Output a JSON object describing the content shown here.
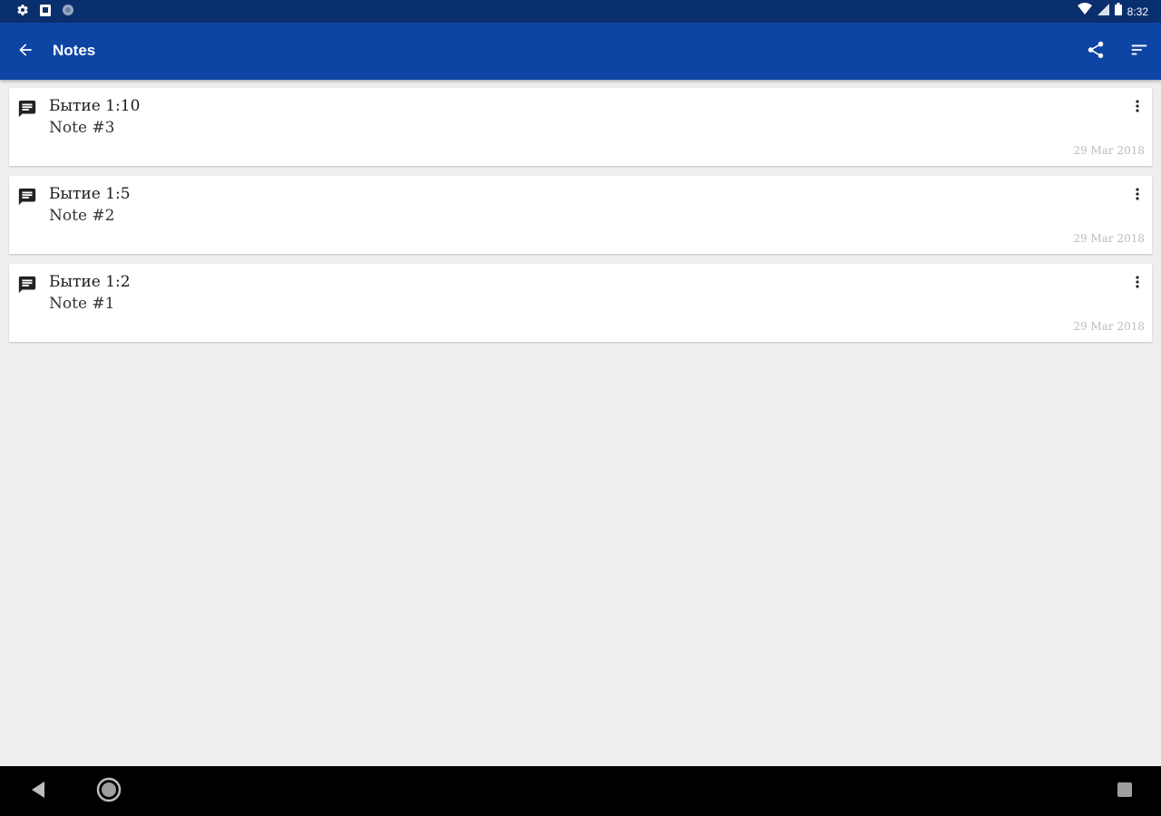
{
  "status_bar": {
    "time": "8:32",
    "left_icons": [
      "settings-icon",
      "sd-card-icon",
      "circle-status-icon"
    ],
    "right_icons": [
      "wifi-icon",
      "signal-icon",
      "battery-icon"
    ]
  },
  "app_bar": {
    "title": "Notes",
    "back_icon": "arrow-back-icon",
    "actions": [
      "share-icon",
      "sort-icon"
    ],
    "color": "#0e45a4"
  },
  "notes": [
    {
      "title": "Бытие 1:10",
      "text": "Note #3",
      "date": "29 Mar 2018"
    },
    {
      "title": "Бытие 1:5",
      "text": "Note #2",
      "date": "29 Mar 2018"
    },
    {
      "title": "Бытие 1:2",
      "text": "Note #1",
      "date": "29 Mar 2018"
    }
  ],
  "nav_bar": {
    "buttons": [
      "back-triangle-icon",
      "home-circle-icon",
      "recents-square-icon"
    ]
  }
}
